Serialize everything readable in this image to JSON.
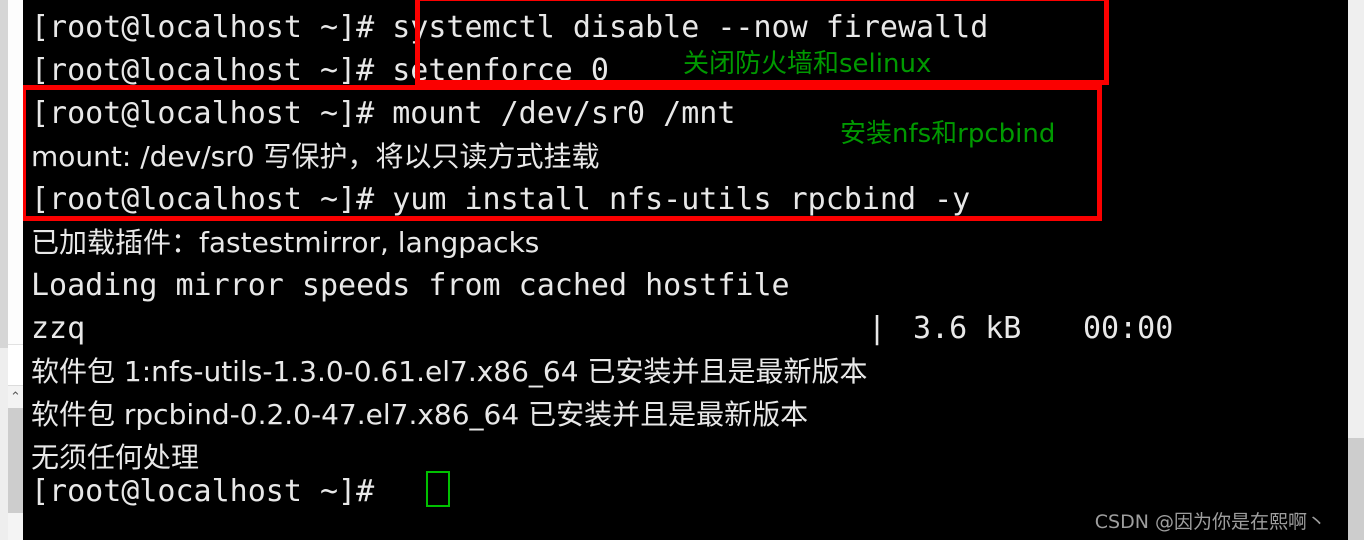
{
  "terminal": {
    "prompt": "[root@localhost ~]# ",
    "lines": [
      {
        "id": "cmd-firewalld",
        "text": "[root@localhost ~]# systemctl disable --now firewalld",
        "kind": "command"
      },
      {
        "id": "cmd-setenforce",
        "text": "[root@localhost ~]# setenforce 0",
        "kind": "command"
      },
      {
        "id": "cmd-mount",
        "text": "[root@localhost ~]# mount /dev/sr0 /mnt",
        "kind": "command"
      },
      {
        "id": "out-mount-warning",
        "text": "mount: /dev/sr0 写保护，将以只读方式挂载",
        "kind": "output"
      },
      {
        "id": "cmd-yum-install",
        "text": "[root@localhost ~]# yum install nfs-utils rpcbind -y",
        "kind": "command"
      },
      {
        "id": "out-plugins",
        "text": "已加载插件：fastestmirror, langpacks",
        "kind": "output"
      },
      {
        "id": "out-mirror-speeds",
        "text": "Loading mirror speeds from cached hostfile",
        "kind": "output"
      },
      {
        "id": "out-repo-zzq",
        "text": "zzq",
        "kind": "output"
      },
      {
        "id": "out-pkg-nfs",
        "text": "软件包 1:nfs-utils-1.3.0-0.61.el7.x86_64 已安装并且是最新版本",
        "kind": "output"
      },
      {
        "id": "out-pkg-rpcbind",
        "text": "软件包 rpcbind-0.2.0-47.el7.x86_64 已安装并且是最新版本",
        "kind": "output"
      },
      {
        "id": "out-nothing-to-do",
        "text": "无须任何处理",
        "kind": "output"
      },
      {
        "id": "prompt-final",
        "text": "[root@localhost ~]# ",
        "kind": "prompt"
      }
    ],
    "repo_meta": {
      "size": "3.6 kB",
      "time": "00:00",
      "separator": "|"
    },
    "colors": {
      "background": "#000000",
      "foreground": "#e8e8e8",
      "annotation_green": "#009900",
      "highlight_red": "#fb0000",
      "cursor_green": "#00c000"
    }
  },
  "annotations": [
    {
      "id": "annotation-firewall",
      "text": "关闭防火墙和selinux"
    },
    {
      "id": "annotation-nfs",
      "text": "安装nfs和rpcbind"
    }
  ],
  "scrollbars": {
    "left": {
      "up_arrow_icon": "^",
      "up_arrow_glyph": "⌃"
    },
    "right": {}
  },
  "watermark": {
    "text": "CSDN @因为你是在熙啊丶"
  }
}
